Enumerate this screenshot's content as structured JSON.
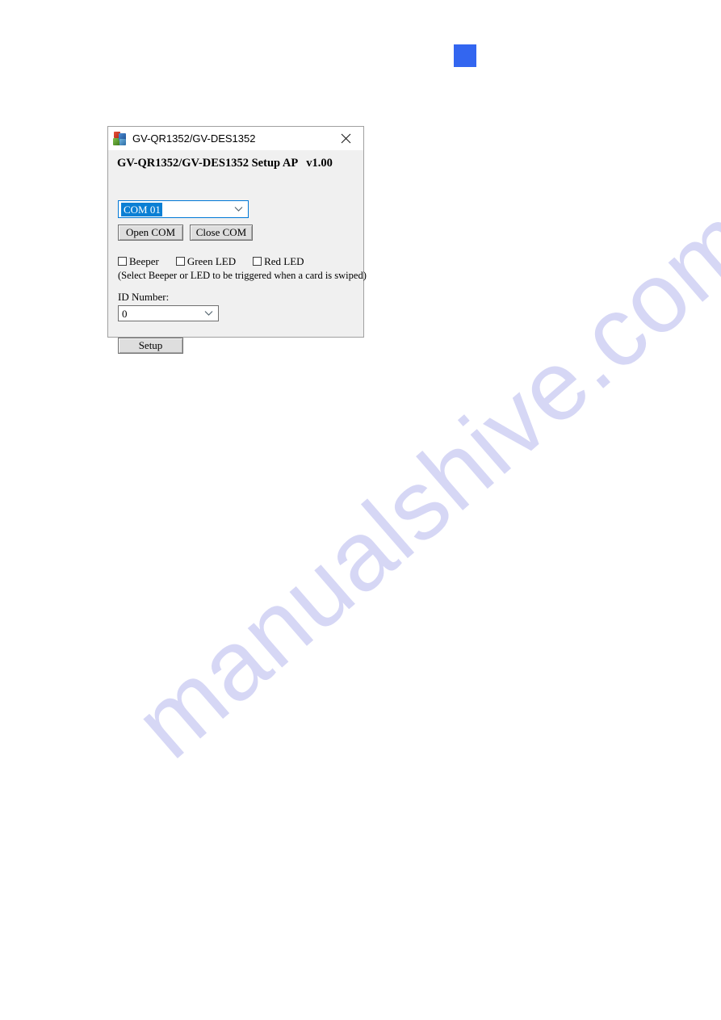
{
  "page": {
    "watermark_text": "manualshive.com",
    "watermark_color": "#d6d7f5",
    "marker_color": "#3366f0"
  },
  "dialog": {
    "titlebar": {
      "title": "GV-QR1352/GV-DES1352",
      "app_icon": "windows-app-icon",
      "close_label": "✕"
    },
    "heading": "GV-QR1352/GV-DES1352 Setup AP   v1.00",
    "com_port": {
      "selected": "COM 01",
      "options": [
        "COM 01"
      ],
      "focus_color": "#0078d7",
      "selection_color": "#0a7fd4"
    },
    "buttons": {
      "open_com": "Open COM",
      "close_com": "Close COM",
      "setup": "Setup"
    },
    "checkboxes": [
      {
        "label": "Beeper",
        "checked": false
      },
      {
        "label": "Green LED",
        "checked": false
      },
      {
        "label": "Red LED",
        "checked": false
      }
    ],
    "hint": "(Select Beeper or LED to be triggered when a card is swiped)",
    "id_number": {
      "label": "ID Number:",
      "selected": "0",
      "options": [
        "0"
      ]
    }
  }
}
